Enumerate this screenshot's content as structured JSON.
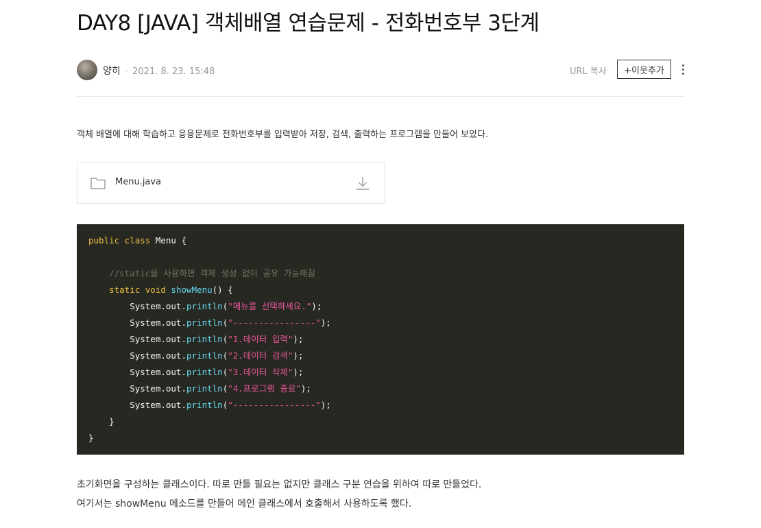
{
  "post": {
    "title": "DAY8 [JAVA] 객체배열 연습문제 - 전화번호부 3단계",
    "author": "양히",
    "date": "2021. 8. 23. 15:48",
    "url_copy_label": "URL 복사",
    "add_neighbor_label": "+이웃추가",
    "intro": "객체 배열에 대해 학습하고 응용문제로 전화번호부를 입력받아 저장, 검색, 출력하는 프로그램을 만들어 보았다.",
    "attachment": {
      "file_name": "Menu.java"
    },
    "paragraphs": [
      "초기화면을 구성하는 클래스이다. 따로 만들 필요는 없지만 클래스 구분 연습을 위하여 따로 만들었다.",
      "여기서는 showMenu 메소드를 만들어 메인 클래스에서 호출해서 사용하도록 했다."
    ]
  },
  "code": {
    "lines": [
      [
        {
          "t": "public class ",
          "c": "kw2"
        },
        {
          "t": "Menu {",
          "c": "plain"
        }
      ],
      [],
      [
        {
          "t": "    //static을 사용하면 객체 생성 없이 공유 가능해짐",
          "c": "cm"
        }
      ],
      [
        {
          "t": "    static void ",
          "c": "kw2"
        },
        {
          "t": "showMenu",
          "c": "fn"
        },
        {
          "t": "() {",
          "c": "plain"
        }
      ],
      [
        {
          "t": "        System.out.",
          "c": "plain"
        },
        {
          "t": "println",
          "c": "fn"
        },
        {
          "t": "(",
          "c": "plain"
        },
        {
          "t": "\"메뉴를 선택하세요.\"",
          "c": "str"
        },
        {
          "t": ");",
          "c": "plain"
        }
      ],
      [
        {
          "t": "        System.out.",
          "c": "plain"
        },
        {
          "t": "println",
          "c": "fn"
        },
        {
          "t": "(",
          "c": "plain"
        },
        {
          "t": "\"----------------\"",
          "c": "str"
        },
        {
          "t": ");",
          "c": "plain"
        }
      ],
      [
        {
          "t": "        System.out.",
          "c": "plain"
        },
        {
          "t": "println",
          "c": "fn"
        },
        {
          "t": "(",
          "c": "plain"
        },
        {
          "t": "\"1.데이터 입력\"",
          "c": "str"
        },
        {
          "t": ");",
          "c": "plain"
        }
      ],
      [
        {
          "t": "        System.out.",
          "c": "plain"
        },
        {
          "t": "println",
          "c": "fn"
        },
        {
          "t": "(",
          "c": "plain"
        },
        {
          "t": "\"2.데이터 검색\"",
          "c": "str"
        },
        {
          "t": ");",
          "c": "plain"
        }
      ],
      [
        {
          "t": "        System.out.",
          "c": "plain"
        },
        {
          "t": "println",
          "c": "fn"
        },
        {
          "t": "(",
          "c": "plain"
        },
        {
          "t": "\"3.데이터 삭제\"",
          "c": "str"
        },
        {
          "t": ");",
          "c": "plain"
        }
      ],
      [
        {
          "t": "        System.out.",
          "c": "plain"
        },
        {
          "t": "println",
          "c": "fn"
        },
        {
          "t": "(",
          "c": "plain"
        },
        {
          "t": "\"4.프로그램 종료\"",
          "c": "str"
        },
        {
          "t": ");",
          "c": "plain"
        }
      ],
      [
        {
          "t": "        System.out.",
          "c": "plain"
        },
        {
          "t": "println",
          "c": "fn"
        },
        {
          "t": "(",
          "c": "plain"
        },
        {
          "t": "\"----------------\"",
          "c": "str"
        },
        {
          "t": ");",
          "c": "plain"
        }
      ],
      [
        {
          "t": "    }",
          "c": "plain"
        }
      ],
      [
        {
          "t": "}",
          "c": "plain"
        }
      ]
    ]
  },
  "icons": {
    "avatar": "author-avatar",
    "more": "more-vertical-icon",
    "folder": "folder-icon",
    "download": "download-icon"
  }
}
